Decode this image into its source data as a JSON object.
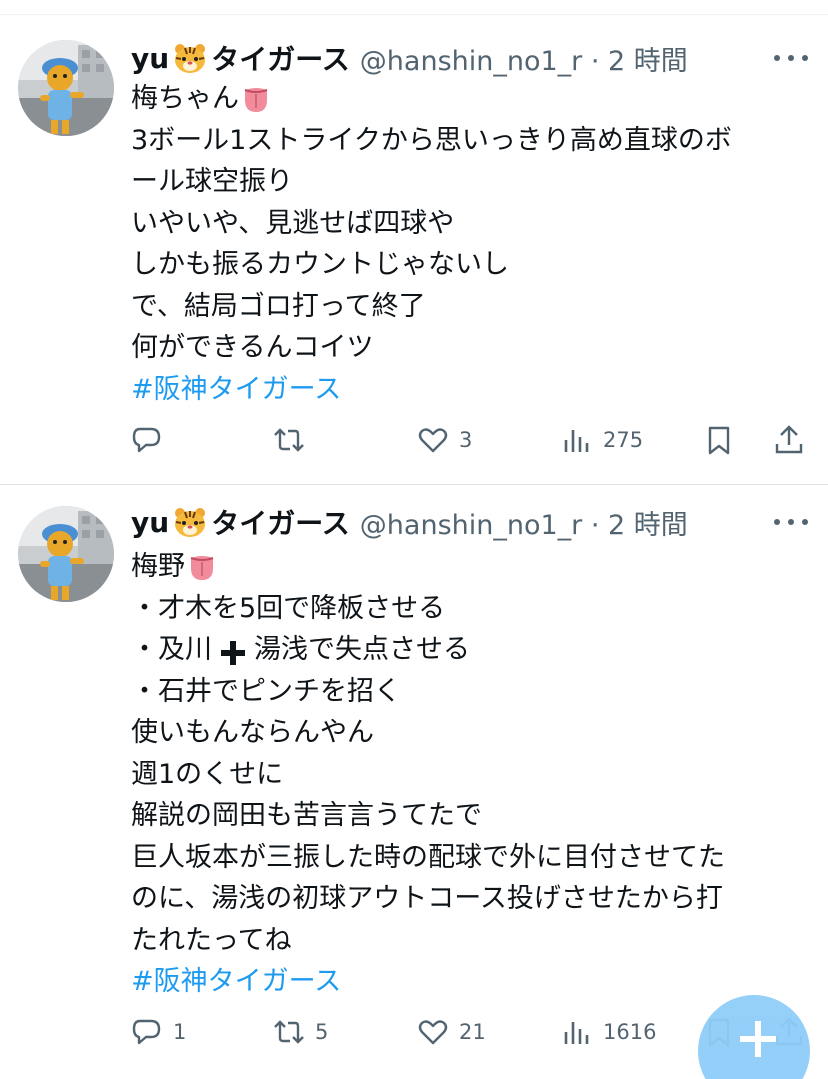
{
  "tweets": [
    {
      "name": "yu",
      "name_suffix": "タイガース",
      "handle_time": "@hanshin_no1_r · 2 時間",
      "lines": [
        "梅ちゃん",
        "3ボール1ストライクから思いっきり高め直球のボ",
        "ール球空振り",
        "いやいや、見逃せば四球や",
        "しかも振るカウントじゃないし",
        "で、結局ゴロ打って終了",
        "何ができるんコイツ"
      ],
      "hashtag": "#阪神タイガース",
      "actions": {
        "reply": "",
        "retweet": "",
        "like": "3",
        "views": "275"
      }
    },
    {
      "name": "yu",
      "name_suffix": "タイガース",
      "handle_time": "@hanshin_no1_r · 2 時間",
      "lines": [
        "梅野",
        "・才木を5回で降板させる",
        "・及川",
        "湯浅で失点させる",
        "・石井でピンチを招く",
        "使いもんならんやん",
        "週1のくせに",
        "解説の岡田も苦言言うてたで",
        "巨人坂本が三振した時の配球で外に目付させてた",
        "のに、湯浅の初球アウトコース投げさせたから打",
        "たれたってね"
      ],
      "hashtag": "#阪神タイガース",
      "actions": {
        "reply": "1",
        "retweet": "5",
        "like": "21",
        "views": "1616"
      }
    }
  ],
  "icons": {
    "reply": "reply-icon",
    "retweet": "retweet-icon",
    "like": "heart-icon",
    "views": "views-icon",
    "bookmark": "bookmark-icon",
    "share": "share-icon",
    "compose": "compose-plus-icon"
  },
  "colors": {
    "text": "#0f1419",
    "secondary": "#536471",
    "hashtag": "#1d9bf0",
    "fab": "#8ecdf8"
  }
}
